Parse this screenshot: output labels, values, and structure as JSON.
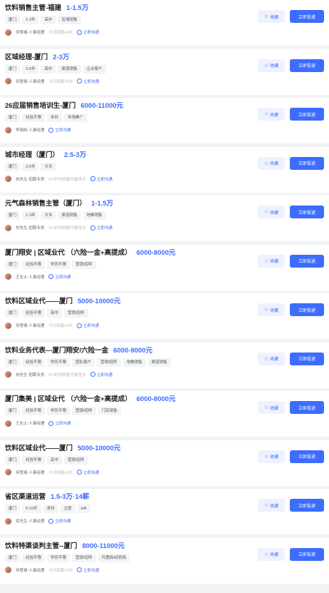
{
  "jobs": [
    {
      "title": "饮料销售主管-福建",
      "salary": "1-1.5万",
      "tags": [
        "厦门",
        "1-3年",
        "高中",
        "区域销售"
      ],
      "hr": "何慧禄·人事经理",
      "reply": "今日回复14次",
      "chat": "立即沟通"
    },
    {
      "title": "区域经理-厦门",
      "salary": "2-3万",
      "tags": [
        "厦门",
        "3-5年",
        "高中",
        "渠道销售",
        "企业客户"
      ],
      "hr": "何慧禄·人事经理",
      "reply": "今日回复14次",
      "chat": "立即沟通"
    },
    {
      "title": "26应届销售培训生-厦门",
      "salary": "6000-11000元",
      "tags": [
        "厦门",
        "经验不限",
        "本科",
        "市场推广"
      ],
      "hr": "李瑞特·人事经理",
      "reply": "",
      "chat": "立即沟通"
    },
    {
      "title": "城市经理（厦门）",
      "salary": "2.5-3万",
      "tags": [
        "厦门",
        "3-5年",
        "大专"
      ],
      "hr": "刘先生·招聘专员",
      "reply": "6小时内回复可能性大",
      "chat": "立即沟通"
    },
    {
      "title": "元气森林销售主管（厦门）",
      "salary": "1-1.5万",
      "tags": [
        "厦门",
        "1-3年",
        "大专",
        "渠道销售",
        "地推销售"
      ],
      "hr": "刘先生·招聘专员",
      "reply": "6小时内回复可能性大",
      "chat": "立即沟通"
    },
    {
      "title": "厦门翔安 | 区域业代 （六险一金+高提成）",
      "salary": "6000-8000元",
      "tags": [
        "厦门",
        "经验不限",
        "学历不限",
        "营销/招呼"
      ],
      "hr": "王女士·人事经理",
      "reply": "",
      "chat": "立即沟通"
    },
    {
      "title": "饮料区域业代——厦门",
      "salary": "5000-10000元",
      "tags": [
        "厦门",
        "经验不限",
        "高中",
        "营销/招呼"
      ],
      "hr": "何慧禄·人事经理",
      "reply": "今日回复14次",
      "chat": "立即沟通"
    },
    {
      "title": "饮料业务代表---厦门翔安/六险一金",
      "salary": "6000-8000元",
      "tags": [
        "厦门",
        "经验不限",
        "学历不限",
        "团队客户",
        "营销/招呼",
        "地推销售",
        "渠道销售"
      ],
      "hr": "刘先生·招聘专员",
      "reply": "6小时内回复可能性大",
      "chat": "立即沟通"
    },
    {
      "title": "厦门集美 | 区域业代 （六险一金+高提成）",
      "salary": "6000-8000元",
      "tags": [
        "厦门",
        "经验不限",
        "学历不限",
        "营销/招呼",
        "门店销售"
      ],
      "hr": "王女士·人事经理",
      "reply": "",
      "chat": "立即沟通"
    },
    {
      "title": "饮料区域业代——厦门",
      "salary": "5000-10000元",
      "tags": [
        "厦门",
        "经验不限",
        "高中",
        "营销/招呼"
      ],
      "hr": "何慧禄·人事经理",
      "reply": "今日回复14次",
      "chat": "立即沟通"
    },
    {
      "title": "省区渠道运营",
      "salary": "1.5-3万·14薪",
      "tags": [
        "厦门",
        "5-10年",
        "本科",
        "主管",
        "toB"
      ],
      "hr": "俞先生·人事经理",
      "reply": "",
      "chat": "立即沟通"
    },
    {
      "title": "饮料特渠谈判主管--厦门",
      "salary": "8000-11000元",
      "tags": [
        "厦门",
        "经验不限",
        "学历不限",
        "营销/招呼",
        "代理商/经销商"
      ],
      "hr": "何慧禄·人事经理",
      "reply": "今日回复14次",
      "chat": "立即沟通"
    }
  ],
  "buttons": {
    "favorite": "收藏",
    "apply": "立即投递",
    "star_icon": "star-icon"
  },
  "colors": {
    "accent": "#3d6cff",
    "background": "#f2f3f5"
  }
}
